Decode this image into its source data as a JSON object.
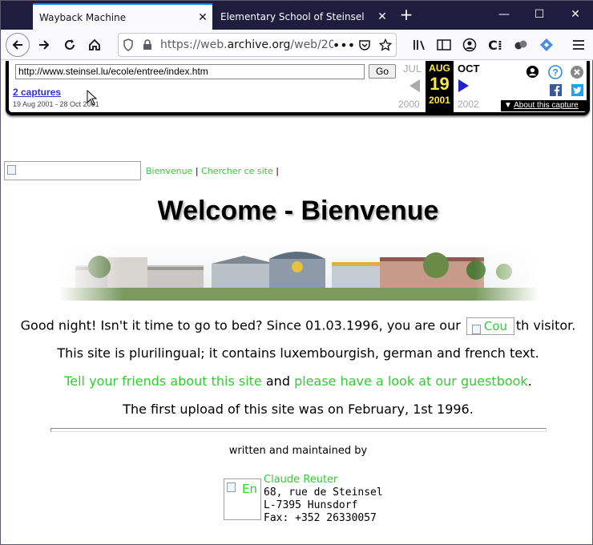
{
  "browser": {
    "tabs": [
      {
        "title": "Wayback Machine",
        "active": true
      },
      {
        "title": "Elementary School of Steinsel",
        "active": false
      }
    ],
    "url_prefix": "https://web.",
    "url_domain": "archive.org",
    "url_suffix": "/web/200",
    "icons": [
      "back-icon",
      "forward-icon",
      "reload-icon",
      "home-icon",
      "shield-icon",
      "lock-icon",
      "more-icon",
      "pocket-icon",
      "star-icon",
      "library-icon",
      "sidebar-icon",
      "account-icon",
      "extension-c-icon",
      "extension-dots-icon",
      "extension-diamond-icon",
      "menu-icon"
    ]
  },
  "wayback": {
    "url_value": "http://www.steinsel.lu/ecole/entree/index.htm",
    "go_label": "Go",
    "captures_link": "2 captures",
    "capture_range": "19 Aug 2001 - 28 Oct 2001",
    "prev_month": "JUL",
    "cur_month": "AUG",
    "next_month": "OCT",
    "cur_day": "19",
    "prev_year": "2000",
    "cur_year": "2001",
    "next_year": "2002",
    "about_label": "About this capture",
    "colors": {
      "highlight": "#ffeb3b",
      "arrow_blue": "#2222cc",
      "arrow_grey": "#aaaaaa"
    }
  },
  "page": {
    "nav": {
      "link1": "Bienvenue",
      "sep1": " | ",
      "link2": "Chercher ce site",
      "sep2": " |"
    },
    "title": "Welcome - Bienvenue",
    "para1_before": "Good night! Isn't it time to go to bed? Since 01.03.1996, you are our ",
    "counter_alt": "Cou",
    "para1_after": "th visitor.",
    "para2": "This site is plurilingual; it contains luxembourgish, german and french text.",
    "para3_link1": "Tell your friends about this site",
    "para3_mid": " and ",
    "para3_link2": "please have a look at our guestbook",
    "para3_end": ".",
    "para4": "The first upload of this site was on February, 1st 1996.",
    "written_by": "written and maintained by",
    "contact_img_alt": "En",
    "contact_name": "Claude Reuter",
    "contact_street": "68, rue de Steinsel",
    "contact_city": "L-7395 Hunsdorf",
    "contact_fax": "Fax: +352 26330057",
    "link_color": "#33cc33"
  }
}
